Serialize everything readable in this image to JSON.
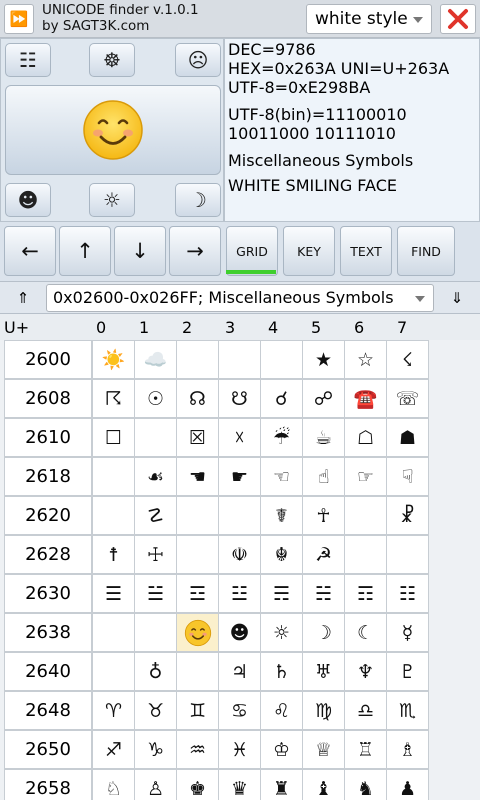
{
  "app": {
    "title_line1": "UNICODE finder v.1.0.1",
    "title_line2": "by SAGT3K.com",
    "menu_icon": "⏩",
    "style_value": "white style",
    "close_icon": "✕"
  },
  "controls": {
    "top_left_icon": "☷",
    "top_mid_icon": "☸",
    "top_right_icon": "☹",
    "preview_char": "☺",
    "bottom_left_icon": "☻",
    "bottom_mid_icon": "☼",
    "bottom_right_icon": "☽"
  },
  "info": {
    "dec": "DEC=9786",
    "hex": "HEX=0x263A  UNI=U+263A",
    "utf8": "UTF-8=0xE298BA",
    "utf8bin_1": "UTF-8(bin)=11100010",
    "utf8bin_2": "10011000 10111010",
    "block": "Miscellaneous Symbols",
    "name": "WHITE SMILING FACE"
  },
  "nav": {
    "left": "←",
    "up": "↑",
    "down": "↓",
    "right": "→",
    "grid": "GRID",
    "key": "KEY",
    "text": "TEXT",
    "find": "FIND"
  },
  "range": {
    "up_icon": "⇑",
    "value": "0x02600-0x026FF; Miscellaneous Symbols",
    "down_icon": "⇓"
  },
  "grid_header": {
    "label": "U+",
    "cols": [
      "0",
      "1",
      "2",
      "3",
      "4",
      "5",
      "6",
      "7"
    ]
  },
  "grid_rows": [
    {
      "code": "2600",
      "cells": [
        "☀️",
        "☁️",
        "",
        "",
        "",
        "★",
        "☆",
        "☇"
      ]
    },
    {
      "code": "2608",
      "cells": [
        "☈",
        "☉",
        "☊",
        "☋",
        "☌",
        "☍",
        "☎️",
        "☏"
      ]
    },
    {
      "code": "2610",
      "cells": [
        "☐",
        "",
        "☒",
        "☓",
        "☔",
        "☕",
        "☖",
        "☗"
      ]
    },
    {
      "code": "2618",
      "cells": [
        "",
        "☙",
        "☚",
        "☛",
        "☜",
        "☝",
        "☞",
        "☟"
      ]
    },
    {
      "code": "2620",
      "cells": [
        "",
        "☡",
        "",
        "",
        "☤",
        "☥",
        "",
        "☧"
      ]
    },
    {
      "code": "2628",
      "cells": [
        "☨",
        "☩",
        "",
        "☫",
        "☬",
        "☭",
        "",
        ""
      ]
    },
    {
      "code": "2630",
      "cells": [
        "☰",
        "☱",
        "☲",
        "☳",
        "☴",
        "☵",
        "☶",
        "☷"
      ]
    },
    {
      "code": "2638",
      "cells": [
        "",
        "",
        "☺",
        "☻",
        "☼",
        "☽",
        "☾",
        "☿"
      ]
    },
    {
      "code": "2640",
      "cells": [
        "",
        "♁",
        "",
        "♃",
        "♄",
        "♅",
        "♆",
        "♇"
      ]
    },
    {
      "code": "2648",
      "cells": [
        "♈",
        "♉",
        "♊",
        "♋",
        "♌",
        "♍",
        "♎",
        "♏"
      ]
    },
    {
      "code": "2650",
      "cells": [
        "♐",
        "♑",
        "♒",
        "♓",
        "♔",
        "♕",
        "♖",
        "♗"
      ]
    },
    {
      "code": "2658",
      "cells": [
        "♘",
        "♙",
        "♚",
        "♛",
        "♜",
        "♝",
        "♞",
        "♟"
      ]
    }
  ],
  "selected": {
    "row": 7,
    "col": 2
  },
  "colors": {
    "accent_green": "#3fcf2f",
    "close_red": "#e0342b",
    "selected_cell": "#fbf0cc"
  }
}
